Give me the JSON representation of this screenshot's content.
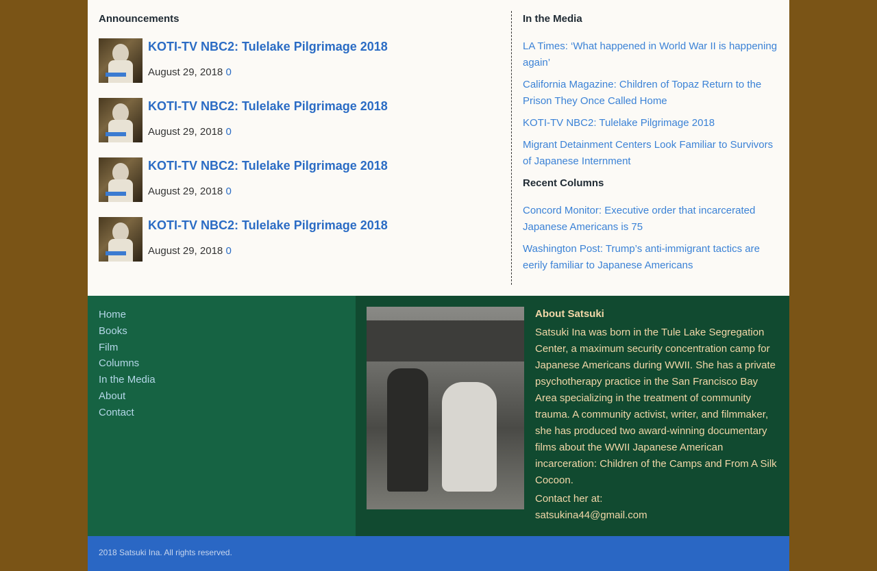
{
  "announcements": {
    "heading": "Announcements",
    "items": [
      {
        "title": "KOTI-TV NBC2: Tulelake Pilgrimage 2018",
        "date": "August 29, 2018",
        "count": "0"
      },
      {
        "title": "KOTI-TV NBC2: Tulelake Pilgrimage 2018",
        "date": "August 29, 2018",
        "count": "0"
      },
      {
        "title": "KOTI-TV NBC2: Tulelake Pilgrimage 2018",
        "date": "August 29, 2018",
        "count": "0"
      },
      {
        "title": "KOTI-TV NBC2: Tulelake Pilgrimage 2018",
        "date": "August 29, 2018",
        "count": "0"
      }
    ]
  },
  "media": {
    "heading": "In the Media",
    "links": [
      "LA Times: ‘What happened in World War II is happening again’",
      "California Magazine: Children of Topaz Return to the Prison They Once Called Home",
      "KOTI-TV NBC2: Tulelake Pilgrimage 2018",
      "Migrant Detainment Centers Look Familiar to Survivors of Japanese Internment"
    ]
  },
  "columns": {
    "heading": "Recent Columns",
    "links": [
      "Concord Monitor: Executive order that incarcerated Japanese Americans is 75",
      "Washington Post: Trump’s anti-immigrant tactics are eerily familiar to Japanese Americans"
    ]
  },
  "footer_nav": [
    "Home",
    "Books",
    "Film",
    "Columns",
    "In the Media",
    "About",
    "Contact"
  ],
  "about": {
    "title": "About Satsuki",
    "text": "Satsuki Ina was born in the Tule Lake Segregation Center, a maximum security concentration camp for Japanese Americans during WWII. She has a private psychotherapy practice in the San Francisco Bay Area specializing in the treatment of community trauma. A community activist, writer, and filmmaker, she has produced two award-winning documentary films about the WWII Japanese American incarceration: Children of the Camps and From A Silk Cocoon.",
    "contact_label": "Contact her at:",
    "contact_email": "satsukina44@gmail.com"
  },
  "copyright": "2018 Satsuki Ina. All rights reserved."
}
